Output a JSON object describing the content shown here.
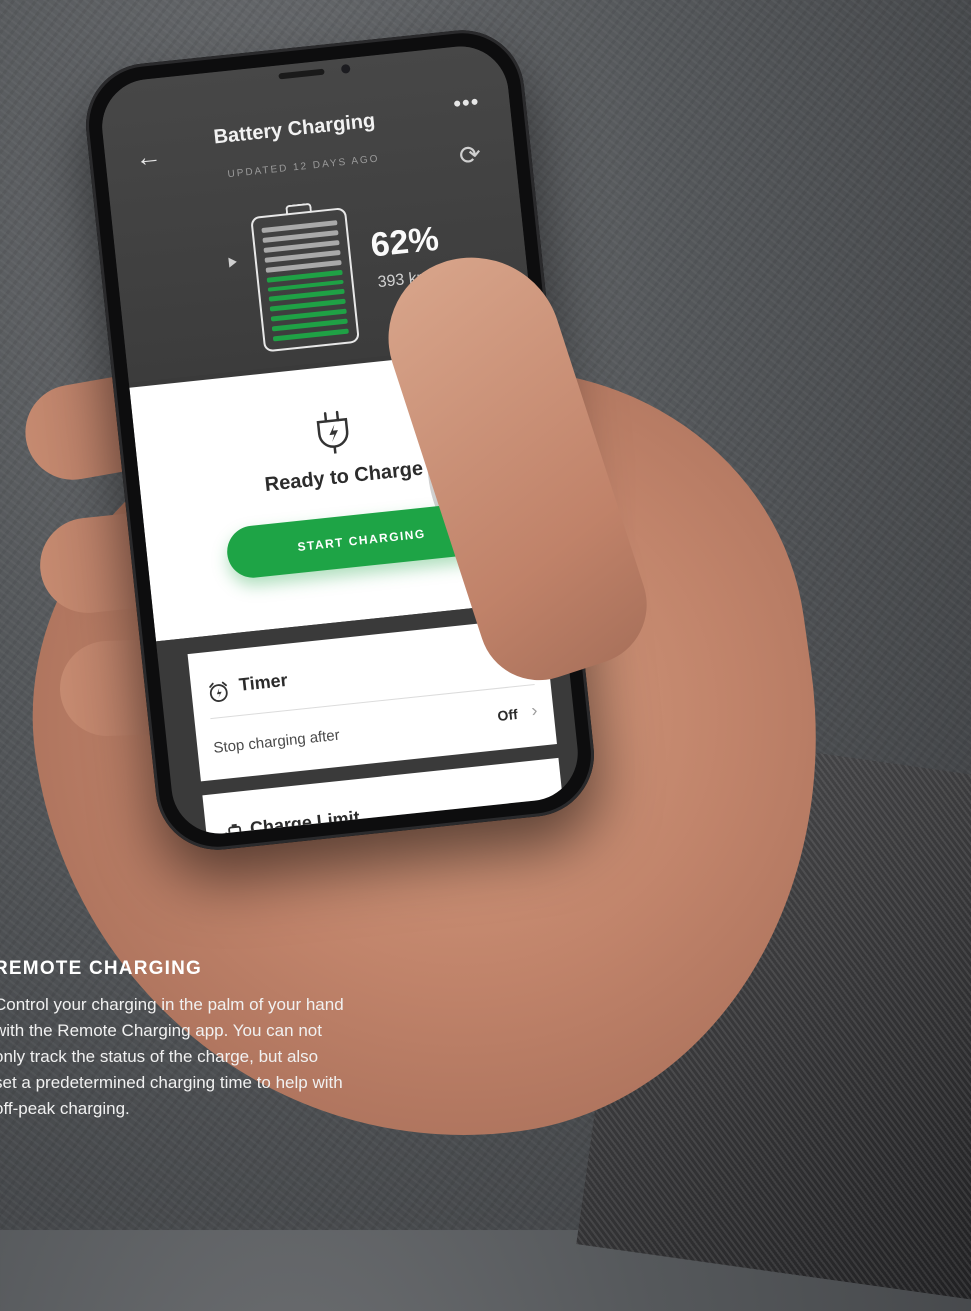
{
  "app": {
    "title": "Battery Charging",
    "updated": "UPDATED 12 DAYS AGO",
    "back_icon": "arrow-left-icon",
    "more_icon": "more-dots-icon",
    "refresh_icon": "refresh-icon"
  },
  "battery": {
    "percent_text": "62%",
    "level": 0.62,
    "range": "393 km",
    "bar_states": [
      "gray",
      "gray",
      "gray",
      "gray",
      "gray",
      "green",
      "green",
      "green",
      "green",
      "green",
      "green",
      "green"
    ]
  },
  "charge_card": {
    "icon": "plug-icon",
    "status": "Ready to Charge",
    "button_label": "START CHARGING"
  },
  "timer": {
    "icon": "alarm-clock-icon",
    "title": "Timer",
    "row_label": "Stop charging after",
    "row_value": "Off"
  },
  "charge_limit": {
    "icon": "battery-limit-icon",
    "title": "Charge Limit"
  },
  "caption": {
    "heading": "REMOTE CHARGING",
    "body": "Control your charging in the palm of your hand with the Remote Charging app. You can not only track the status of the charge, but also set a predetermined charging time to help with off-peak charging."
  },
  "colors": {
    "accent_green": "#1ea446",
    "screen_dark": "#3c3c3c",
    "card_white": "#ffffff"
  }
}
